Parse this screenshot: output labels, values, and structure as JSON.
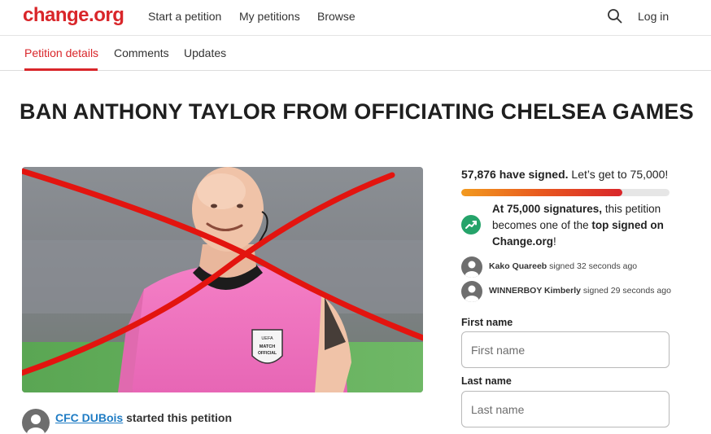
{
  "header": {
    "logo": "change.org",
    "nav": [
      "Start a petition",
      "My petitions",
      "Browse"
    ],
    "login": "Log in"
  },
  "tabs": [
    "Petition details",
    "Comments",
    "Updates"
  ],
  "petition": {
    "title": "BAN ANTHONY TAYLOR FROM OFFICIATING CHELSEA GAMES",
    "starter_name": "CFC DUBois",
    "starter_suffix": "started this petition"
  },
  "signatures": {
    "count": "57,876 have signed.",
    "goal_text": "Let’s get to 75,000!",
    "progress_fraction": 0.7717,
    "milestone_bold": "At 75,000 signatures,",
    "milestone_mid": "this petition becomes one of the",
    "milestone_top": "top signed",
    "milestone_on": "on Change.org",
    "milestone_end": "!"
  },
  "recent_signers": [
    {
      "name": "Kako Quareeb",
      "text": "signed 32 seconds ago"
    },
    {
      "name": "WINNERBOY Kimberly",
      "text": "signed 29 seconds ago"
    }
  ],
  "form": {
    "first_label": "First name",
    "first_placeholder": "First name",
    "last_label": "Last name",
    "last_placeholder": "Last name"
  },
  "image_badge": {
    "line1": "UEFA",
    "line2": "MATCH",
    "line3": "OFFICIAL"
  },
  "colors": {
    "brand": "#d9262a",
    "link": "#1f7cc4",
    "trend": "#25a36a"
  },
  "icons": {
    "search": "search-icon",
    "trend": "trending-up-icon",
    "avatar": "user-avatar-icon"
  }
}
